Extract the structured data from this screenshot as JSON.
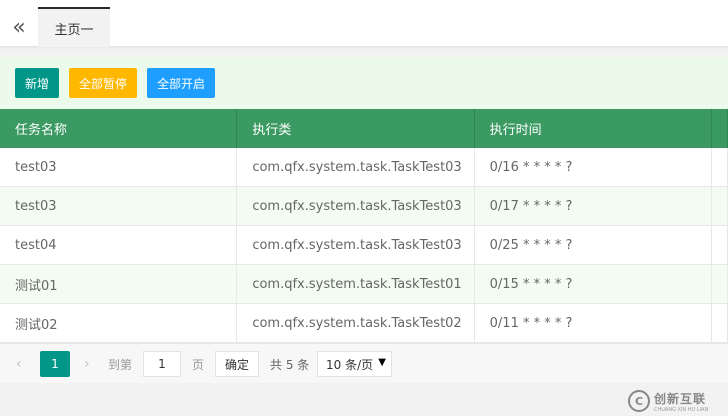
{
  "tabs": {
    "collapse_icon": "«",
    "active_label": "主页一"
  },
  "toolbar": {
    "add_label": "新增",
    "pause_all_label": "全部暂停",
    "start_all_label": "全部开启"
  },
  "table": {
    "columns": [
      "任务名称",
      "执行类",
      "执行时间"
    ],
    "rows": [
      [
        "test03",
        "com.qfx.system.task.TaskTest03",
        "0/16 * * * * ?"
      ],
      [
        "test03",
        "com.qfx.system.task.TaskTest03",
        "0/17 * * * * ?"
      ],
      [
        "test04",
        "com.qfx.system.task.TaskTest03",
        "0/25 * * * * ?"
      ],
      [
        "测试01",
        "com.qfx.system.task.TaskTest01",
        "0/15 * * * * ?"
      ],
      [
        "测试02",
        "com.qfx.system.task.TaskTest02",
        "0/11 * * * * ?"
      ]
    ]
  },
  "pager": {
    "prev_icon": "‹",
    "next_icon": "›",
    "current_page": "1",
    "goto_label": "到第",
    "goto_value": "1",
    "page_unit": "页",
    "confirm_label": "确定",
    "total_label": "共 5 条",
    "page_size_label": "10 条/页",
    "page_size_caret": "▼"
  },
  "watermark": {
    "logo_letter": "C",
    "cn": "创新互联",
    "en": "CHUANG XIN HU LIAN"
  },
  "colors": {
    "header_green": "#3a9a62",
    "add_button": "#009688",
    "pause_button": "#ffb800",
    "start_button": "#1e9fff",
    "toolbar_bg": "#ebfaeb"
  }
}
